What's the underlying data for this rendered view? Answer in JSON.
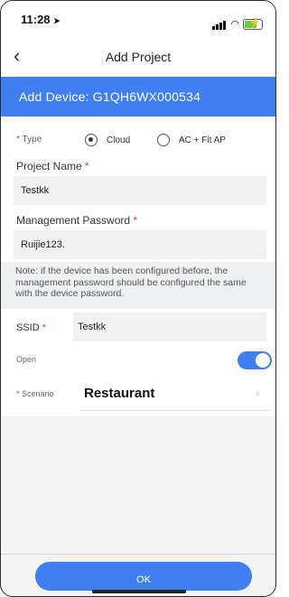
{
  "status": {
    "time": "11:28",
    "location_icon": "location-arrow-icon"
  },
  "nav": {
    "title": "Add Project",
    "back_icon": "chevron-left-icon"
  },
  "banner": {
    "text": "Add Device: G1QH6WX000534"
  },
  "type": {
    "label": "Type",
    "options": [
      {
        "label": "Cloud",
        "selected": true
      },
      {
        "label": "AC + Fit AP",
        "selected": false
      }
    ]
  },
  "project_name": {
    "label": "Project Name",
    "value": "Testkk"
  },
  "password": {
    "label": "Management Password",
    "value": "Ruijie123."
  },
  "note": "Note: if the device has been configured before, the management password should be configured the same with the device password.",
  "ssid": {
    "label": "SSID",
    "value": "Testkk"
  },
  "open": {
    "label": "Open",
    "enabled": true
  },
  "scenario": {
    "label": "Scenario",
    "value": "Restaurant"
  },
  "ok_button": "OK",
  "required_mark": "*",
  "colors": {
    "accent": "#3f7ff0",
    "required": "#e23b3b"
  }
}
